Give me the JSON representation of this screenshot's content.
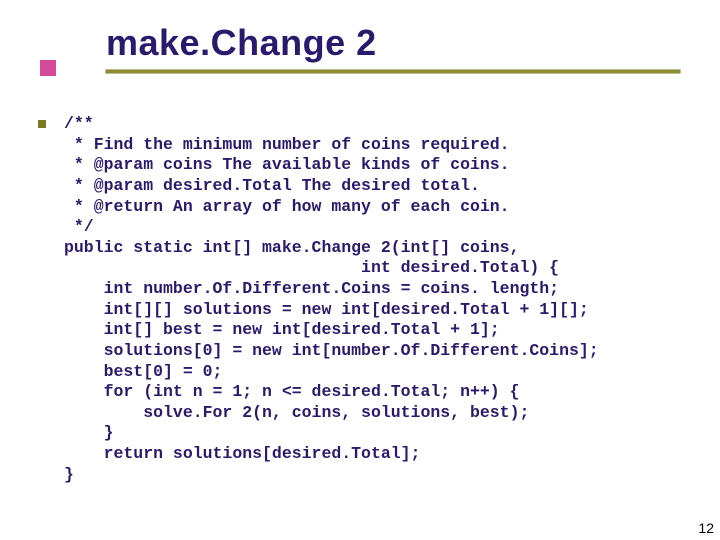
{
  "slide": {
    "title": "make.Change 2",
    "page_number": "12",
    "code_lines": [
      "/**",
      " * Find the minimum number of coins required.",
      " * @param coins The available kinds of coins.",
      " * @param desired.Total The desired total.",
      " * @return An array of how many of each coin.",
      " */",
      "public static int[] make.Change 2(int[] coins,",
      "                              int desired.Total) {",
      "    int number.Of.Different.Coins = coins. length;",
      "    int[][] solutions = new int[desired.Total + 1][];",
      "    int[] best = new int[desired.Total + 1];",
      "    solutions[0] = new int[number.Of.Different.Coins];",
      "    best[0] = 0;",
      "    for (int n = 1; n <= desired.Total; n++) {",
      "        solve.For 2(n, coins, solutions, best);",
      "    }",
      "    return solutions[desired.Total];",
      "}"
    ]
  },
  "colors": {
    "title": "#2a1a6e",
    "underline": "#8e8e2e",
    "accent": "#d64a9a",
    "bullet": "#7a7a1f",
    "code": "#2a1a6e"
  }
}
